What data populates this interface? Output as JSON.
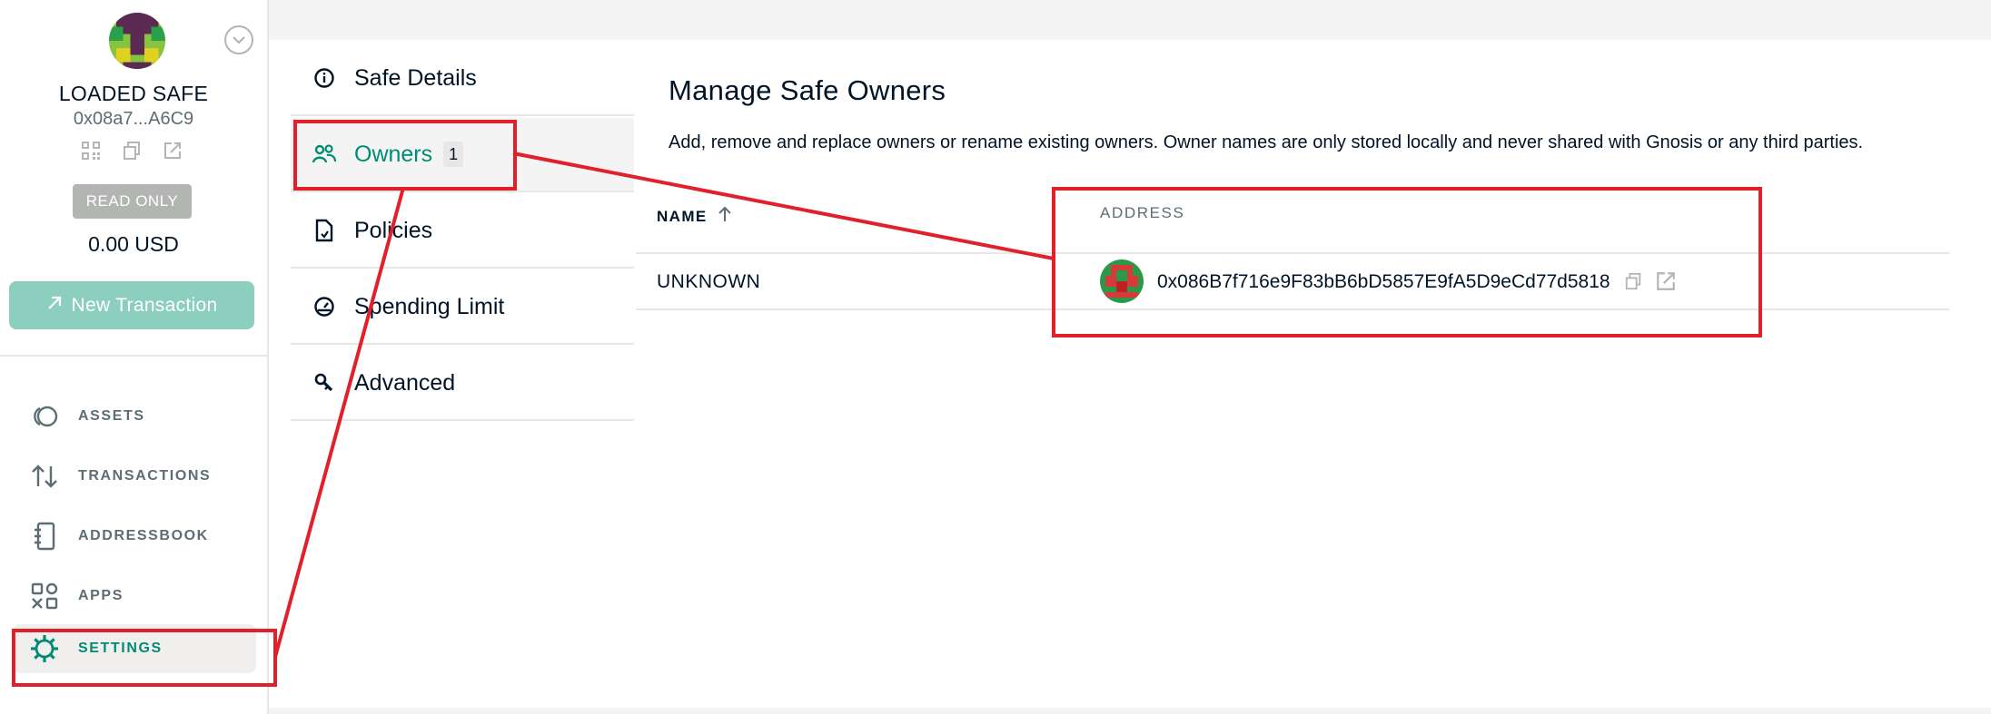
{
  "sidebar": {
    "safe_name": "LOADED SAFE",
    "safe_address": "0x08a7...A6C9",
    "read_only_label": "READ ONLY",
    "balance": "0.00 USD",
    "new_transaction_label": "New Transaction",
    "nav": [
      {
        "label": "ASSETS",
        "icon": "assets-icon"
      },
      {
        "label": "TRANSACTIONS",
        "icon": "transactions-icon"
      },
      {
        "label": "ADDRESSBOOK",
        "icon": "addressbook-icon"
      },
      {
        "label": "APPS",
        "icon": "apps-icon"
      },
      {
        "label": "SETTINGS",
        "icon": "settings-icon",
        "active": true
      }
    ]
  },
  "settings_menu": {
    "items": [
      {
        "label": "Safe Details",
        "icon": "info-icon"
      },
      {
        "label": "Owners",
        "icon": "owners-icon",
        "badge": "1",
        "active": true
      },
      {
        "label": "Policies",
        "icon": "policies-icon"
      },
      {
        "label": "Spending Limit",
        "icon": "spending-limit-icon"
      },
      {
        "label": "Advanced",
        "icon": "wrench-icon"
      }
    ]
  },
  "main": {
    "title": "Manage Safe Owners",
    "description": "Add, remove and replace owners or rename existing owners. Owner names are only stored locally and never shared with Gnosis or any third parties.",
    "table": {
      "columns": [
        "NAME",
        "ADDRESS"
      ],
      "rows": [
        {
          "name": "UNKNOWN",
          "address": "0x086B7f716e9F83bB6bD5857E9fA5D9eCd77d5818"
        }
      ]
    }
  },
  "colors": {
    "accent": "#008c73",
    "button_bg": "#8ccfbf",
    "annotation_red": "#e0202b",
    "muted_text": "#5d6d74"
  }
}
